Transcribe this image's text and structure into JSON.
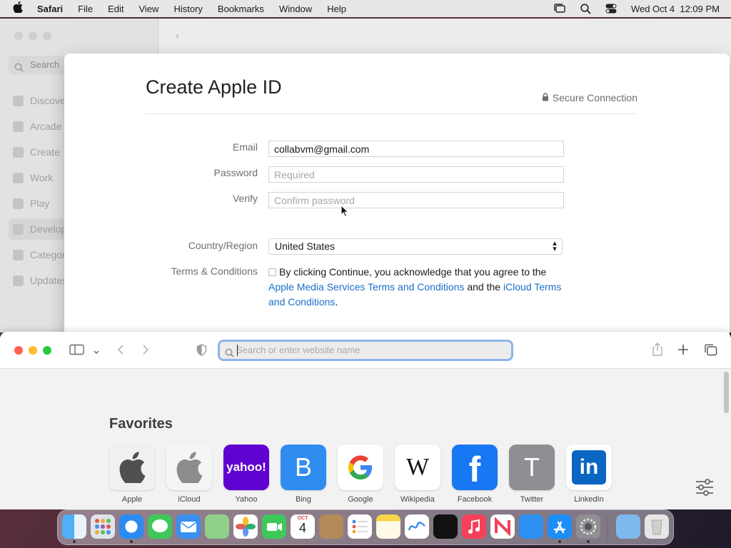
{
  "menubar": {
    "app_name": "Safari",
    "items": [
      "File",
      "Edit",
      "View",
      "History",
      "Bookmarks",
      "Window",
      "Help"
    ],
    "datetime": "Wed Oct 4  12:09 PM"
  },
  "app_store": {
    "search_label": "Search",
    "nav": [
      "Discover",
      "Arcade",
      "Create",
      "Work",
      "Play",
      "Develop",
      "Categories",
      "Updates"
    ]
  },
  "sheet": {
    "title": "Create Apple ID",
    "secure_label": "Secure Connection",
    "email_label": "Email",
    "email_value": "collabvm@gmail.com",
    "password_label": "Password",
    "password_placeholder": "Required",
    "verify_label": "Verify",
    "verify_placeholder": "Confirm password",
    "country_label": "Country/Region",
    "country_value": "United States",
    "terms_label": "Terms & Conditions",
    "terms_text_1": "By clicking Continue, you acknowledge that you agree to the",
    "terms_link_1": "Apple Media Services Terms and Conditions",
    "terms_text_2": " and the ",
    "terms_link_2": "iCloud Terms and Conditions",
    "terms_text_3": "."
  },
  "safari": {
    "address_placeholder": "Search or enter website name",
    "favorites_title": "Favorites",
    "favorites": [
      {
        "label": "Apple",
        "glyph": ""
      },
      {
        "label": "iCloud",
        "glyph": ""
      },
      {
        "label": "Yahoo",
        "glyph": "yahoo!"
      },
      {
        "label": "Bing",
        "glyph": "B"
      },
      {
        "label": "Google",
        "glyph": "G"
      },
      {
        "label": "Wikipedia",
        "glyph": "W"
      },
      {
        "label": "Facebook",
        "glyph": "f"
      },
      {
        "label": "Twitter",
        "glyph": "T"
      },
      {
        "label": "LinkedIn",
        "glyph": "in"
      }
    ]
  },
  "dock": {
    "calendar_month": "OCT",
    "calendar_day": "4"
  },
  "colors": {
    "link": "#1a6fc8",
    "focus_ring": "#8eb4ea",
    "close": "#ff5f57",
    "minimize": "#febc2e",
    "zoom": "#28c840"
  }
}
